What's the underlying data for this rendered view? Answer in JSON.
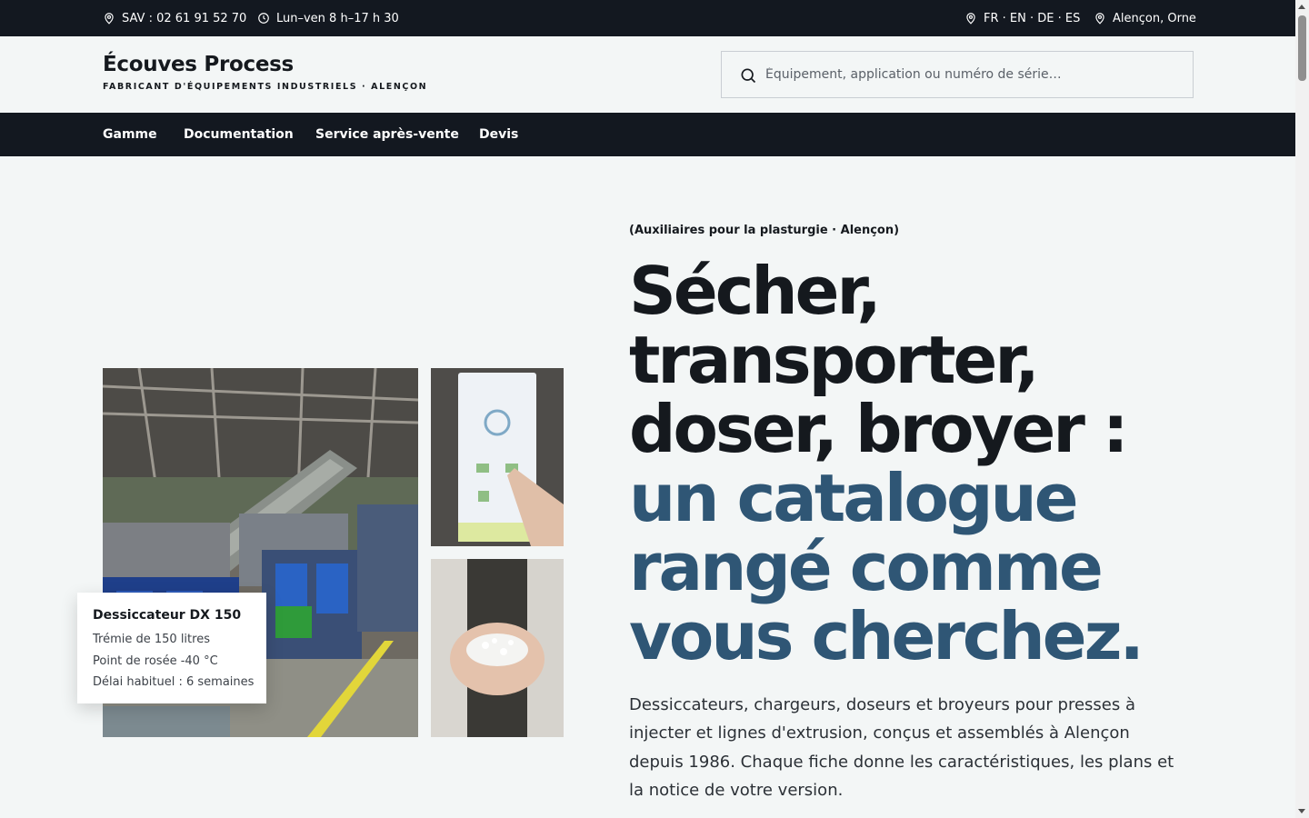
{
  "topbar": {
    "support_phone": "SAV : 02 61 91 52 70",
    "hours": "Lun–ven 8 h–17 h 30",
    "languages": "FR · EN · DE · ES",
    "location": "Alençon, Orne"
  },
  "brand": {
    "name": "Écouves Process",
    "tagline": "FABRICANT D'ÉQUIPEMENTS INDUSTRIELS · ALENÇON"
  },
  "search": {
    "placeholder": "Équipement, application ou numéro de série…"
  },
  "nav": {
    "items": [
      "Gamme",
      "Documentation",
      "Service après-vente",
      "Devis"
    ]
  },
  "hero": {
    "eyebrow": "(Auxiliaires pour la plasturgie · Alençon)",
    "headline_lines": [
      "Sécher,",
      "transporter,",
      "doser, broyer :"
    ],
    "headline_accent_lines": [
      "un catalogue",
      "rangé comme",
      "vous cherchez."
    ],
    "lead": "Dessiccateurs, chargeurs, doseurs et broyeurs pour presses à injecter et lignes d'extrusion, conçus et assemblés à Alençon depuis 1986. Chaque fiche donne les caractéristiques, les plans et la notice de votre version.",
    "accent_color": "#2f5675"
  },
  "spec_card": {
    "title": "Dessiccateur DX 150",
    "lines": [
      "Trémie de 150 litres",
      "Point de rosée -40 °C",
      "Délai habituel : 6 semaines"
    ]
  },
  "colors": {
    "dark_bar": "#131820",
    "page_background": "#f3f6f6",
    "text": "#15191e"
  }
}
